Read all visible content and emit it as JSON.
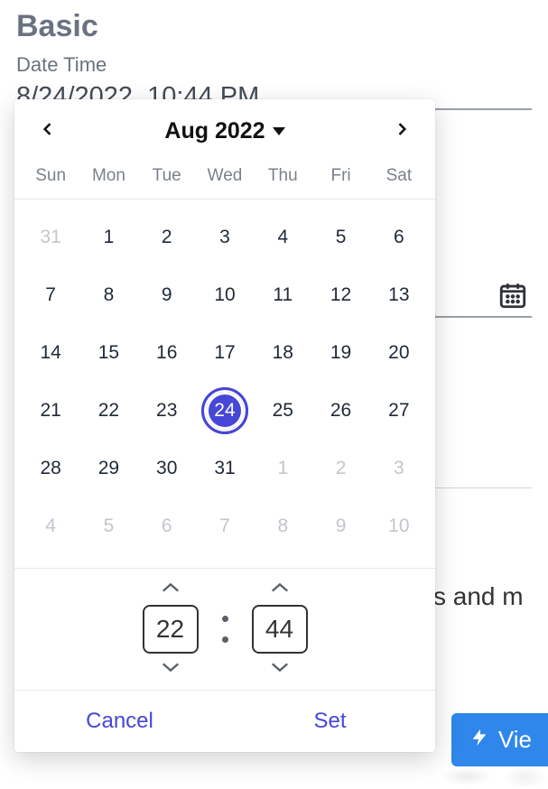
{
  "heading": "Basic",
  "field_label": "Date Time",
  "field_value": "8/24/2022, 10:44 PM",
  "background_partial_text": "s and m",
  "view_button_label": "Vie",
  "picker": {
    "month_label": "Aug 2022",
    "dow": [
      "Sun",
      "Mon",
      "Tue",
      "Wed",
      "Thu",
      "Fri",
      "Sat"
    ],
    "selected_day": 24,
    "weeks": [
      [
        {
          "n": 31,
          "o": true
        },
        {
          "n": 1
        },
        {
          "n": 2
        },
        {
          "n": 3
        },
        {
          "n": 4
        },
        {
          "n": 5
        },
        {
          "n": 6
        }
      ],
      [
        {
          "n": 7
        },
        {
          "n": 8
        },
        {
          "n": 9
        },
        {
          "n": 10
        },
        {
          "n": 11
        },
        {
          "n": 12
        },
        {
          "n": 13
        }
      ],
      [
        {
          "n": 14
        },
        {
          "n": 15
        },
        {
          "n": 16
        },
        {
          "n": 17
        },
        {
          "n": 18
        },
        {
          "n": 19
        },
        {
          "n": 20
        }
      ],
      [
        {
          "n": 21
        },
        {
          "n": 22
        },
        {
          "n": 23
        },
        {
          "n": 24,
          "sel": true
        },
        {
          "n": 25
        },
        {
          "n": 26
        },
        {
          "n": 27
        }
      ],
      [
        {
          "n": 28
        },
        {
          "n": 29
        },
        {
          "n": 30
        },
        {
          "n": 31
        },
        {
          "n": 1,
          "o": true
        },
        {
          "n": 2,
          "o": true
        },
        {
          "n": 3,
          "o": true
        }
      ],
      [
        {
          "n": 4,
          "o": true
        },
        {
          "n": 5,
          "o": true
        },
        {
          "n": 6,
          "o": true
        },
        {
          "n": 7,
          "o": true
        },
        {
          "n": 8,
          "o": true
        },
        {
          "n": 9,
          "o": true
        },
        {
          "n": 10,
          "o": true
        }
      ]
    ],
    "hour": "22",
    "minute": "44",
    "cancel_label": "Cancel",
    "set_label": "Set"
  }
}
